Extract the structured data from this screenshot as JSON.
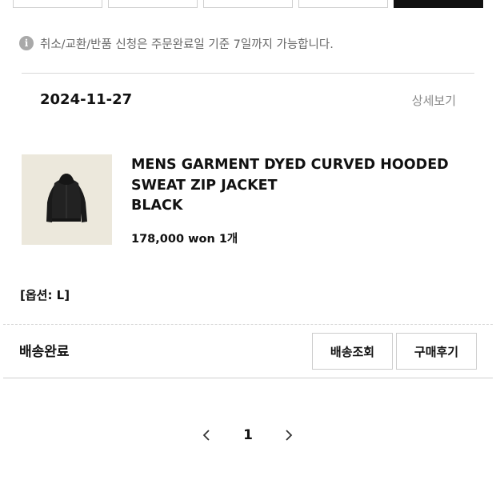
{
  "top_buttons": [
    "",
    "",
    "",
    "",
    ""
  ],
  "notice": {
    "icon": "info-icon",
    "icon_glyph": "i",
    "text": "취소/교환/반품 신청은 주문완료일 기준 7일까지 가능합니다."
  },
  "order": {
    "date": "2024-11-27",
    "detail_link": "상세보기",
    "product": {
      "thumbnail": "black-hooded-zip-jacket-photo",
      "name_lines": [
        "MENS GARMENT DYED CURVED HOODED",
        "SWEAT ZIP JACKET",
        "BLACK"
      ],
      "price_qty": "178,000 won 1개"
    },
    "option": "[옵션: L]",
    "status": "배송완료",
    "actions": {
      "track": "배송조회",
      "review": "구매후기"
    }
  },
  "pagination": {
    "prev_icon": "chevron-left-icon",
    "current_page": "1",
    "next_icon": "chevron-right-icon"
  },
  "colors": {
    "text": "#111111",
    "muted": "#888888",
    "icon_gray": "#a9a9a9",
    "thumbnail_bg": "#ece8dc",
    "border": "#cccccc"
  }
}
